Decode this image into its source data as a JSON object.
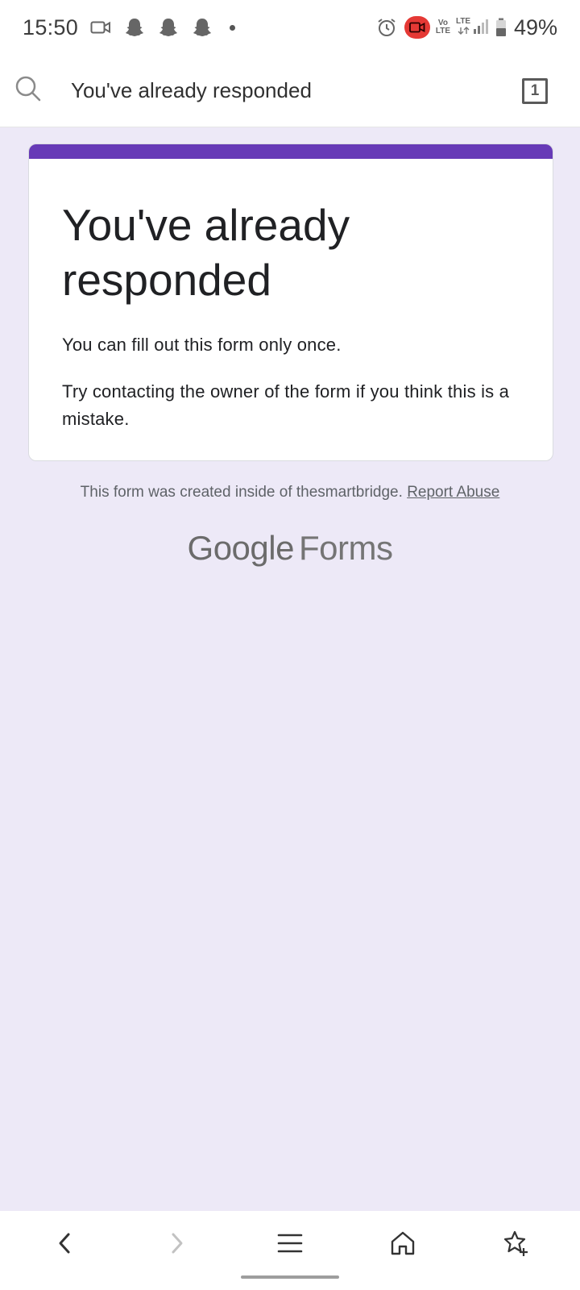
{
  "status_bar": {
    "time": "15:50",
    "battery": "49%",
    "network_top": "LTE",
    "volte_top": "Vo",
    "volte_bottom": "LTE",
    "icons": [
      "video-camera-icon",
      "snapchat-icon",
      "snapchat-icon",
      "snapchat-icon",
      "notification-dot-icon",
      "alarm-icon",
      "screen-record-icon",
      "volte-icon",
      "lte-signal-icon",
      "battery-icon"
    ],
    "record_color": "#e53935"
  },
  "browser": {
    "url_text": "You've already responded",
    "tab_count": "1"
  },
  "card": {
    "accent_color": "#673ab7",
    "title": "You've already responded",
    "message_1": "You can fill out this form only once.",
    "message_2": "Try contacting the owner of the form if you think this is a mistake."
  },
  "footer": {
    "note": "This form was created inside of thesmartbridge.",
    "report_link": "Report Abuse"
  },
  "logo": {
    "google": "Google",
    "forms": "Forms"
  },
  "bottom_nav": {
    "items": [
      "back-icon",
      "forward-icon",
      "menu-icon",
      "home-icon",
      "bookmark-add-icon"
    ]
  }
}
